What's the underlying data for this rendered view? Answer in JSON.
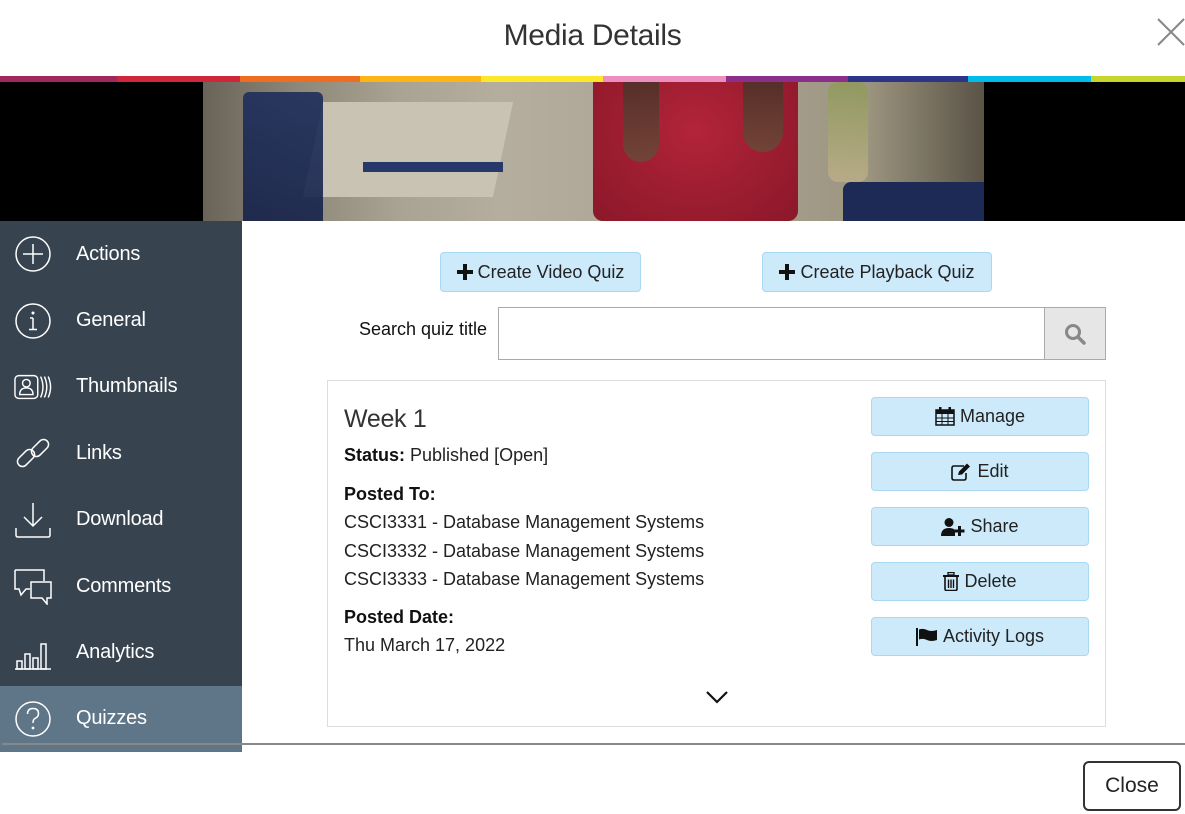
{
  "header": {
    "title": "Media Details",
    "close_icon": "close-x-icon"
  },
  "brand_stripe": {
    "colors": [
      "#a0285e",
      "#d0263a",
      "#ef6c23",
      "#fdb515",
      "#fde72b",
      "#ec8ec0",
      "#8b2f8b",
      "#2e3487",
      "#00bce8",
      "#c6d62e"
    ]
  },
  "video": {
    "description": "video thumbnail preview"
  },
  "sidebar": {
    "items": [
      {
        "label": "Actions",
        "icon": "plus-circle-icon",
        "active": false
      },
      {
        "label": "General",
        "icon": "info-circle-icon",
        "active": false
      },
      {
        "label": "Thumbnails",
        "icon": "thumbnails-icon",
        "active": false
      },
      {
        "label": "Links",
        "icon": "link-icon",
        "active": false
      },
      {
        "label": "Download",
        "icon": "download-icon",
        "active": false
      },
      {
        "label": "Comments",
        "icon": "comments-icon",
        "active": false
      },
      {
        "label": "Analytics",
        "icon": "analytics-icon",
        "active": false
      },
      {
        "label": "Quizzes",
        "icon": "question-circle-icon",
        "active": true
      }
    ]
  },
  "main": {
    "create_video_quiz": "Create Video Quiz",
    "create_playback_quiz": "Create Playback Quiz",
    "search": {
      "label": "Search quiz title",
      "value": "",
      "placeholder": ""
    },
    "quizzes": [
      {
        "title": "Week 1",
        "status_label": "Status:",
        "status_value": "Published [Open]",
        "posted_to_label": "Posted To:",
        "posted_to": [
          "CSCI3331 - Database Management Systems",
          "CSCI3332 - Database Management Systems",
          "CSCI3333 - Database Management Systems"
        ],
        "posted_date_label": "Posted Date:",
        "posted_date": "Thu March 17, 2022",
        "actions": [
          {
            "label": "Manage",
            "icon": "calendar-icon"
          },
          {
            "label": "Edit",
            "icon": "edit-icon"
          },
          {
            "label": "Share",
            "icon": "user-plus-icon"
          },
          {
            "label": "Delete",
            "icon": "trash-icon"
          },
          {
            "label": "Activity Logs",
            "icon": "flag-icon"
          }
        ]
      }
    ]
  },
  "footer": {
    "close_label": "Close"
  }
}
